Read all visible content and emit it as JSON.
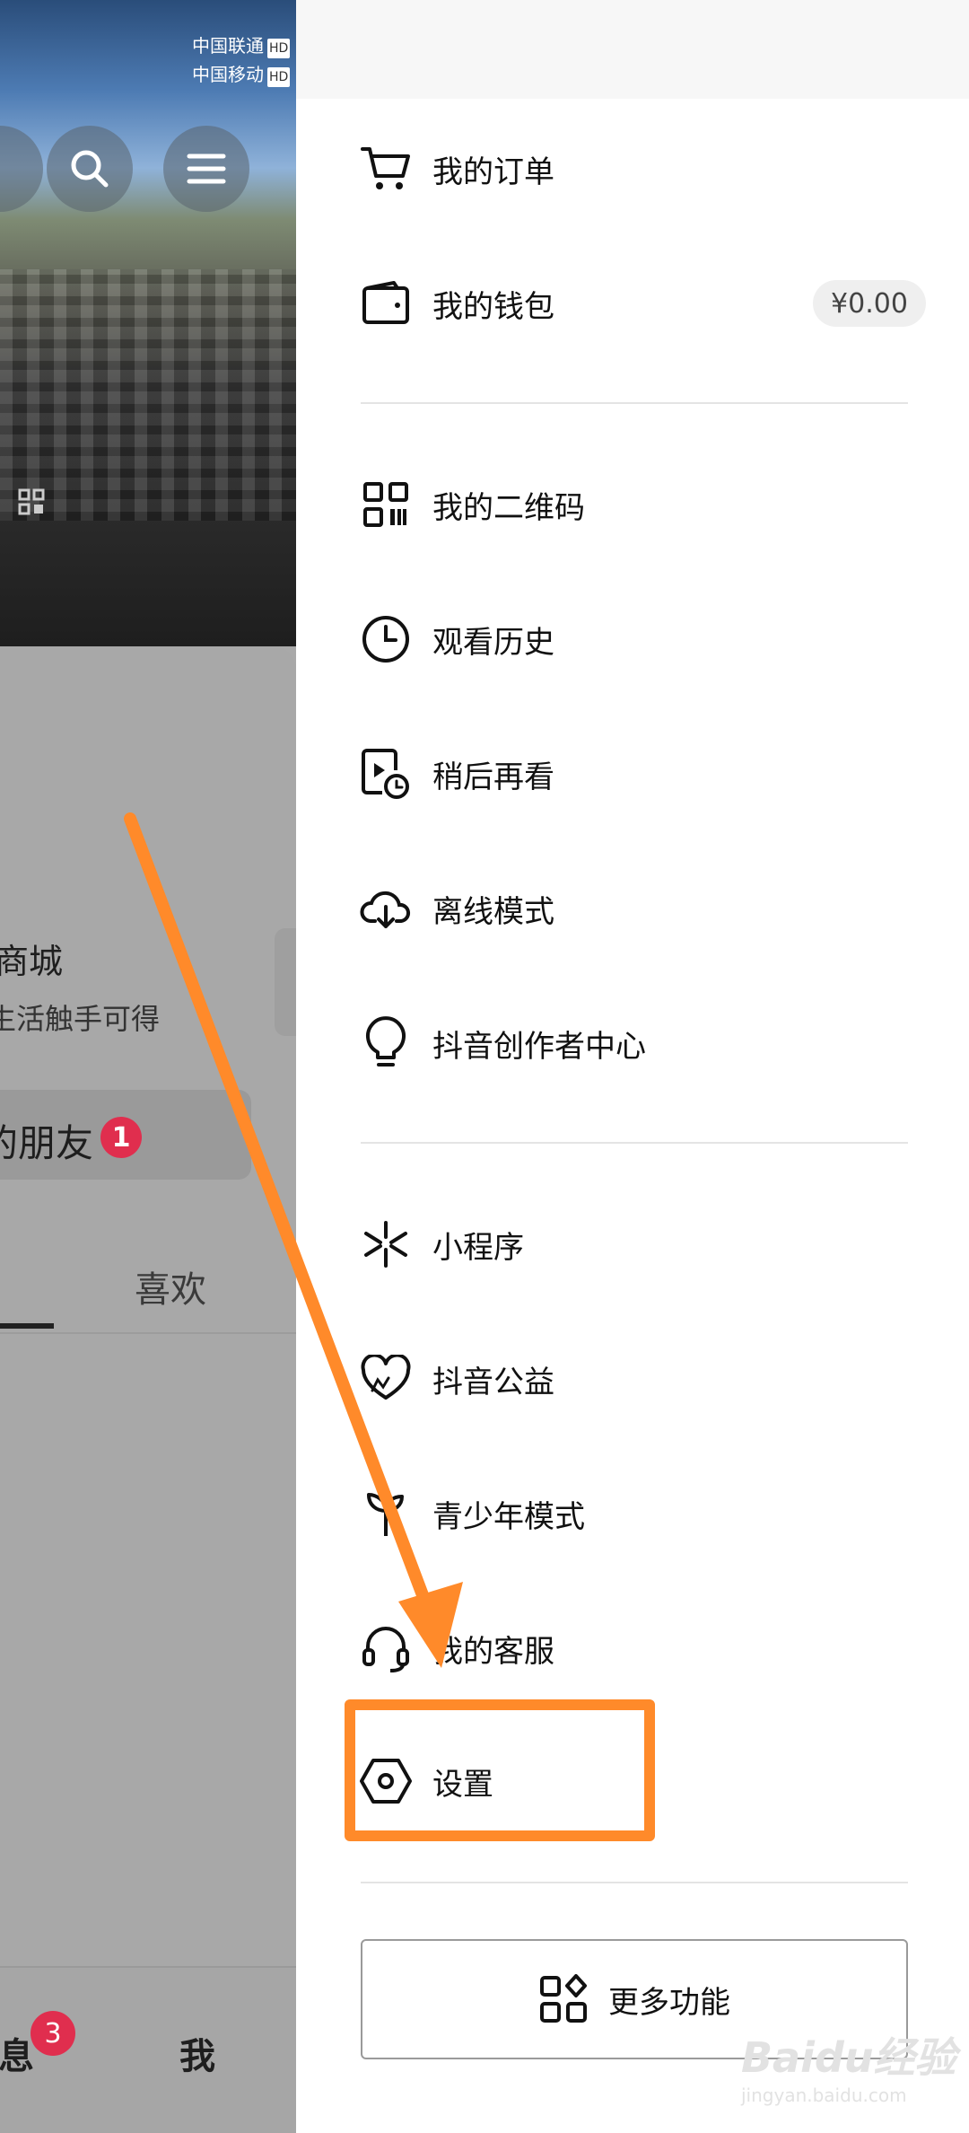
{
  "status": {
    "carrier1": "中国联通",
    "carrier2": "中国移动",
    "hd": "HD"
  },
  "background_app": {
    "mall_title": "商城",
    "mall_subtitle": "生活触手可得",
    "friends_label": "的朋友",
    "friends_badge": "1",
    "tab_likes": "喜欢",
    "nav_messages": "消息",
    "nav_messages_badge": "3",
    "nav_me": "我"
  },
  "drawer": {
    "section1": [
      {
        "label": "我的订单",
        "icon": "cart-icon"
      },
      {
        "label": "我的钱包",
        "icon": "wallet-icon",
        "value": "¥0.00"
      }
    ],
    "section2": [
      {
        "label": "我的二维码",
        "icon": "qrcode-icon"
      },
      {
        "label": "观看历史",
        "icon": "clock-icon"
      },
      {
        "label": "稍后再看",
        "icon": "watch-later-icon"
      },
      {
        "label": "离线模式",
        "icon": "cloud-download-icon"
      },
      {
        "label": "抖音创作者中心",
        "icon": "bulb-icon"
      }
    ],
    "section3": [
      {
        "label": "小程序",
        "icon": "mini-program-icon"
      },
      {
        "label": "抖音公益",
        "icon": "heart-icon"
      },
      {
        "label": "青少年模式",
        "icon": "sprout-icon"
      },
      {
        "label": "我的客服",
        "icon": "headset-icon"
      },
      {
        "label": "设置",
        "icon": "settings-hex-icon"
      }
    ],
    "more_button": "更多功能"
  },
  "annotation": {
    "highlight_color": "#ff8a2a",
    "target": "设置"
  },
  "watermark": {
    "text": "Baidu经验",
    "url_text": "jingyan.baidu.com"
  }
}
